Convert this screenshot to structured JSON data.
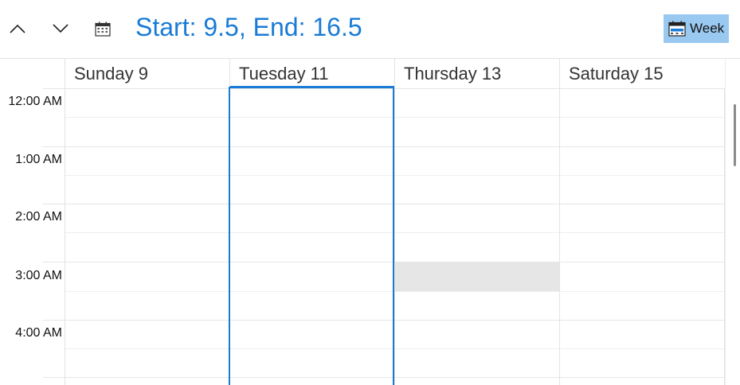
{
  "toolbar": {
    "title": "Start: 9.5, End: 16.5",
    "view_label": "Week",
    "icons": [
      "chevron-up-icon",
      "chevron-down-icon",
      "calendar-icon",
      "week-view-icon"
    ]
  },
  "days": [
    {
      "label": "Sunday 9",
      "selected": false
    },
    {
      "label": "Tuesday 11",
      "selected": true
    },
    {
      "label": "Thursday 13",
      "selected": false
    },
    {
      "label": "Saturday 15",
      "selected": false
    }
  ],
  "times": [
    "12:00 AM",
    "1:00 AM",
    "2:00 AM",
    "3:00 AM",
    "4:00 AM"
  ],
  "colors": {
    "accent": "#1a7bd6",
    "view_button_bg": "#99c9f0",
    "highlight_cell": "#e6e6e6",
    "gridline": "#e3e3e3"
  }
}
